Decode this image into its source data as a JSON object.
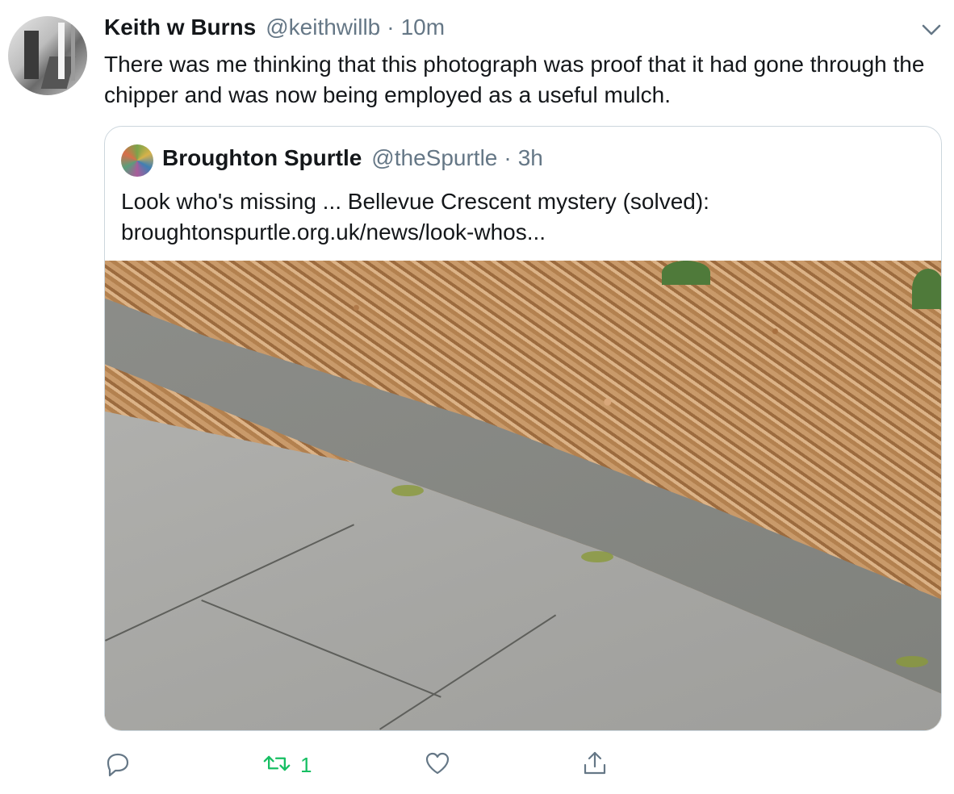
{
  "tweet": {
    "author_name": "Keith w Burns",
    "author_handle": "@keithwillb",
    "separator": "·",
    "time": "10m",
    "text": "There was me thinking that this photograph was proof that it had gone through the chipper and was now being employed as a useful mulch."
  },
  "quoted": {
    "author_name": "Broughton Spurtle",
    "author_handle": "@theSpurtle",
    "separator": "·",
    "time": "3h",
    "text_line1": "Look who's missing ... Bellevue Crescent mystery (solved):",
    "text_line2": "broughtonspurtle.org.uk/news/look-whos..."
  },
  "actions": {
    "retweet_count": "1",
    "retweet_color": "#17bf63",
    "icon_color": "#657786"
  },
  "icons": [
    "caret-down-icon",
    "reply-icon",
    "retweet-icon",
    "like-icon",
    "share-icon"
  ]
}
